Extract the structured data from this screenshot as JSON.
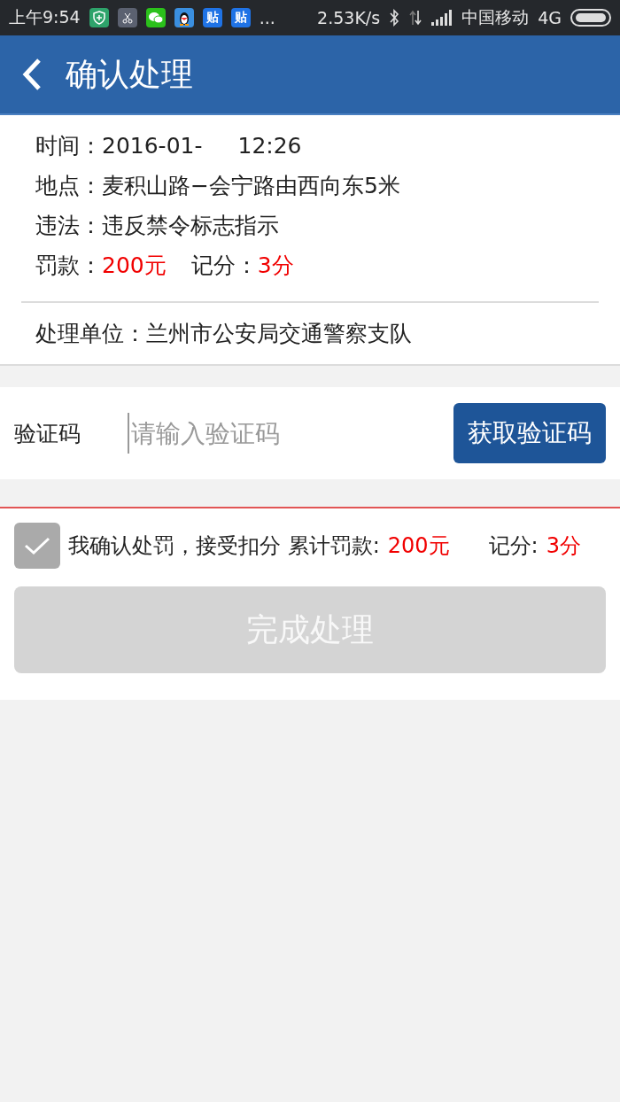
{
  "status_bar": {
    "time": "上午9:54",
    "apps": [
      {
        "kind": "shield"
      },
      {
        "kind": "scissors"
      },
      {
        "kind": "chat"
      },
      {
        "kind": "penguin"
      },
      {
        "kind": "tile",
        "label": "贴"
      },
      {
        "kind": "tile",
        "label": "贴"
      }
    ],
    "more": "...",
    "speed": "2.53K/s",
    "carrier": "中国移动",
    "network": "4G"
  },
  "header": {
    "title": "确认处理"
  },
  "details": [
    {
      "kind": "time",
      "label": "时间：",
      "parts": [
        "2016-01-",
        "12:26"
      ]
    },
    {
      "kind": "plain",
      "label": "地点：",
      "value": "麦积山路−会宁路由西向东5米"
    },
    {
      "kind": "plain",
      "label": "违法：",
      "value": "违反禁令标志指示"
    },
    {
      "kind": "fine",
      "label": "罚款：",
      "value": "200元",
      "label_2": "记分：",
      "value_2": "3分"
    }
  ],
  "unit": {
    "label": "处理单位：",
    "value": "兰州市公安局交通警察支队"
  },
  "verify": {
    "label": "验证码",
    "placeholder": "请输入验证码",
    "button": "获取验证码"
  },
  "confirm": {
    "checked": true,
    "text": "我确认处罚，接受扣分 累计罚款:",
    "fine": "200元",
    "points_label": "记分:",
    "points": "3分"
  },
  "submit": {
    "label": "完成处理",
    "disabled": true
  }
}
